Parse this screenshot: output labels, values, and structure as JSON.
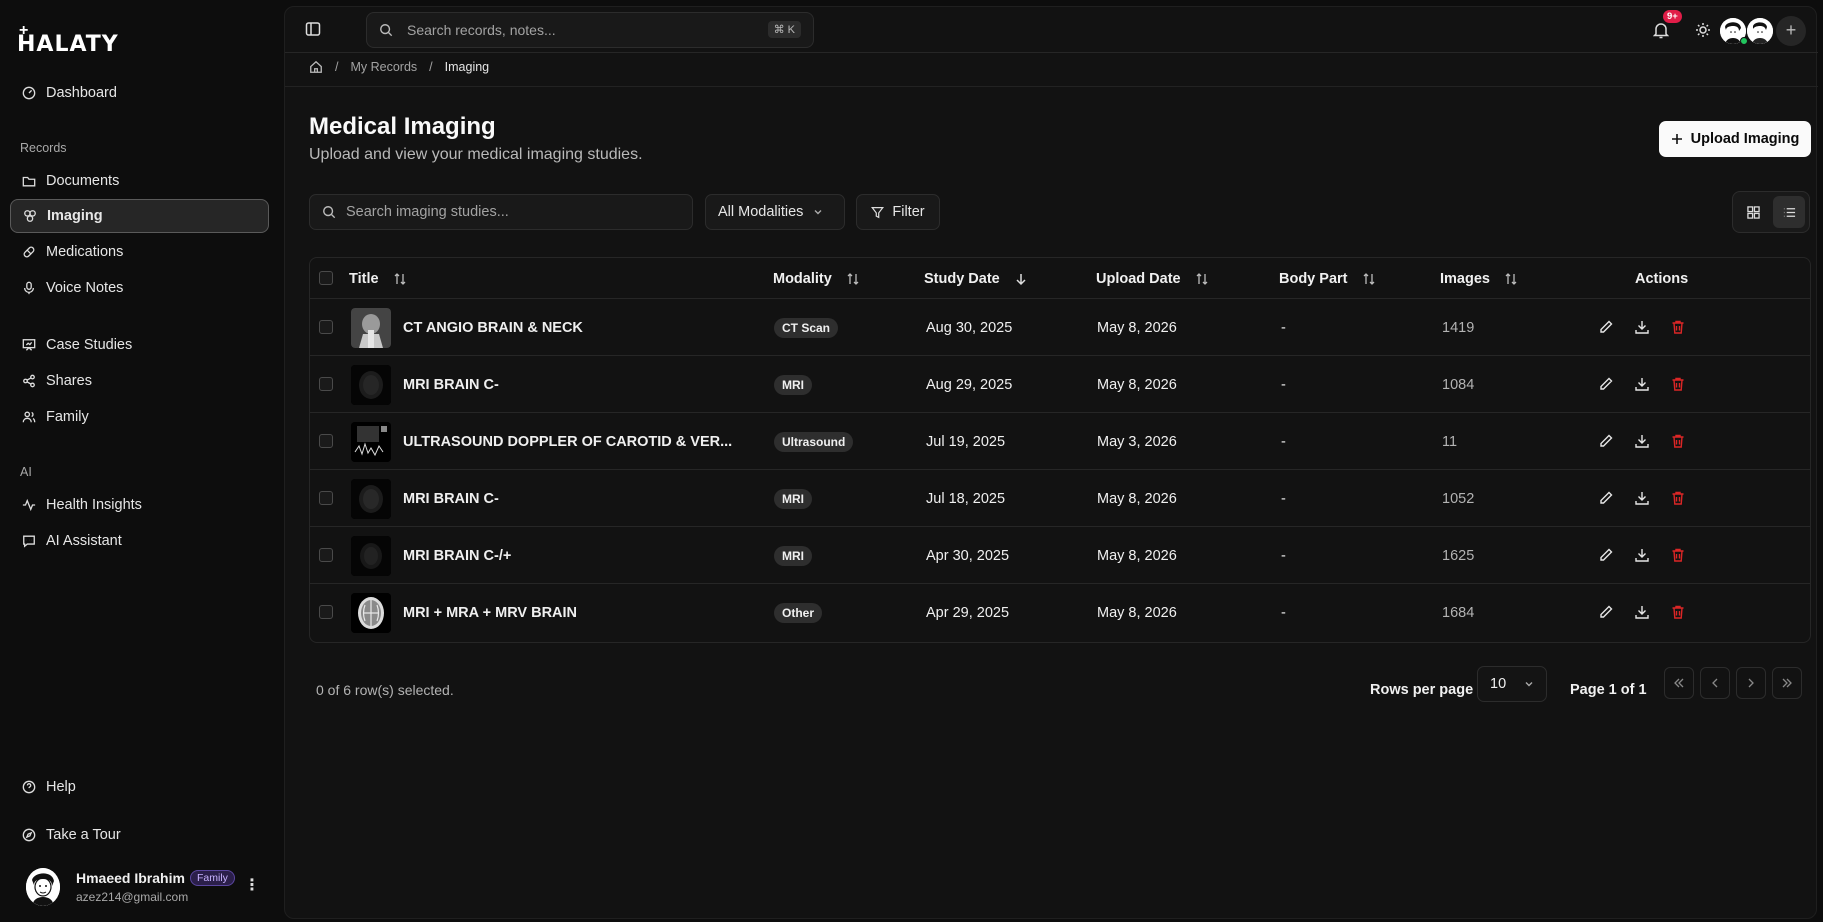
{
  "brand": {
    "name": "HALATY",
    "plus": "+"
  },
  "sidebar": {
    "top_items": [
      {
        "label": "Dashboard",
        "icon": "dashboard-icon"
      }
    ],
    "sections": [
      {
        "title": "Records"
      },
      {
        "title": "AI"
      }
    ],
    "records_items": [
      {
        "label": "Documents",
        "icon": "folder-icon"
      },
      {
        "label": "Imaging",
        "icon": "imaging-icon",
        "active": true
      },
      {
        "label": "Medications",
        "icon": "pill-icon"
      },
      {
        "label": "Voice Notes",
        "icon": "mic-icon"
      },
      {
        "label": "Case Studies",
        "icon": "presentation-icon"
      },
      {
        "label": "Shares",
        "icon": "share-icon"
      },
      {
        "label": "Family",
        "icon": "users-icon"
      }
    ],
    "ai_items": [
      {
        "label": "Health Insights",
        "icon": "activity-icon"
      },
      {
        "label": "AI Assistant",
        "icon": "chat-icon"
      }
    ],
    "bottom_items": [
      {
        "label": "Help",
        "icon": "help-icon"
      },
      {
        "label": "Take a Tour",
        "icon": "compass-icon"
      }
    ],
    "user": {
      "name": "Hmaeed Ibrahim",
      "badge": "Family",
      "email": "azez214@gmail.com"
    }
  },
  "topbar": {
    "search_placeholder": "Search records, notes...",
    "shortcut": "⌘ K",
    "notif_count": "9+",
    "add_label": "+"
  },
  "breadcrumb": {
    "items": [
      "My Records",
      "Imaging"
    ],
    "separator": "/"
  },
  "page": {
    "title": "Medical Imaging",
    "subtitle": "Upload and view your medical imaging studies.",
    "upload_label": "Upload Imaging"
  },
  "filters": {
    "search_placeholder": "Search imaging studies...",
    "modality": "All Modalities",
    "filter_label": "Filter"
  },
  "table": {
    "columns": [
      "Title",
      "Modality",
      "Study Date",
      "Upload Date",
      "Body Part",
      "Images",
      "Actions"
    ],
    "rows": [
      {
        "title": "CT ANGIO BRAIN & NECK",
        "modality": "CT Scan",
        "study_date": "Aug 30, 2025",
        "upload_date": "May 8, 2026",
        "body_part": "-",
        "images": "1419"
      },
      {
        "title": "MRI BRAIN C-",
        "modality": "MRI",
        "study_date": "Aug 29, 2025",
        "upload_date": "May 8, 2026",
        "body_part": "-",
        "images": "1084"
      },
      {
        "title": "ULTRASOUND DOPPLER OF CAROTID & VER...",
        "modality": "Ultrasound",
        "study_date": "Jul 19, 2025",
        "upload_date": "May 3, 2026",
        "body_part": "-",
        "images": "11"
      },
      {
        "title": "MRI BRAIN C-",
        "modality": "MRI",
        "study_date": "Jul 18, 2025",
        "upload_date": "May 8, 2026",
        "body_part": "-",
        "images": "1052"
      },
      {
        "title": "MRI BRAIN C-/+",
        "modality": "MRI",
        "study_date": "Apr 30, 2025",
        "upload_date": "May 8, 2026",
        "body_part": "-",
        "images": "1625"
      },
      {
        "title": "MRI + MRA + MRV BRAIN",
        "modality": "Other",
        "study_date": "Apr 29, 2025",
        "upload_date": "May 8, 2026",
        "body_part": "-",
        "images": "1684"
      }
    ]
  },
  "footer": {
    "selected": "0 of 6 row(s) selected.",
    "rows_per_page_label": "Rows per page",
    "rows_per_page": "10",
    "page_info": "Page 1 of 1"
  },
  "colors": {
    "background": "#0d0d0d",
    "panel": "#121212",
    "danger": "#dc2626",
    "online": "#22c55e",
    "badge": "#e11d48"
  }
}
